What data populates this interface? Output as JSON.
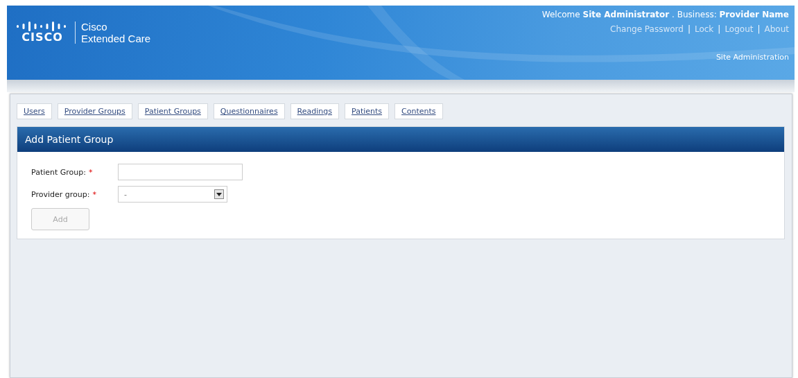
{
  "header": {
    "logo_word": "CISCO",
    "product_lines": [
      "Cisco",
      "Extended Care"
    ],
    "welcome": "Welcome",
    "user": "Site Administrator",
    "separator": ".",
    "business_label": "Business:",
    "business": "Provider Name",
    "links": [
      "Change Password",
      "Lock",
      "Logout",
      "About"
    ],
    "link_separator": "|",
    "section": "Site Administration"
  },
  "tabs": [
    {
      "label": "Users",
      "selected": false
    },
    {
      "label": "Provider Groups",
      "selected": false
    },
    {
      "label": "Patient Groups",
      "selected": false
    },
    {
      "label": "Questionnaires",
      "selected": false
    },
    {
      "label": "Readings",
      "selected": false
    },
    {
      "label": "Patients",
      "selected": false
    },
    {
      "label": "Contents",
      "selected": false
    }
  ],
  "form": {
    "title": "Add Patient Group",
    "fields": [
      {
        "kind": "text",
        "label": "Patient Group:",
        "required": true,
        "required_mark": "*"
      },
      {
        "kind": "select",
        "label": "Provider group:",
        "required": true,
        "required_mark": "*",
        "value": "-"
      }
    ],
    "button": {
      "label": "Add",
      "disabled": true
    }
  }
}
